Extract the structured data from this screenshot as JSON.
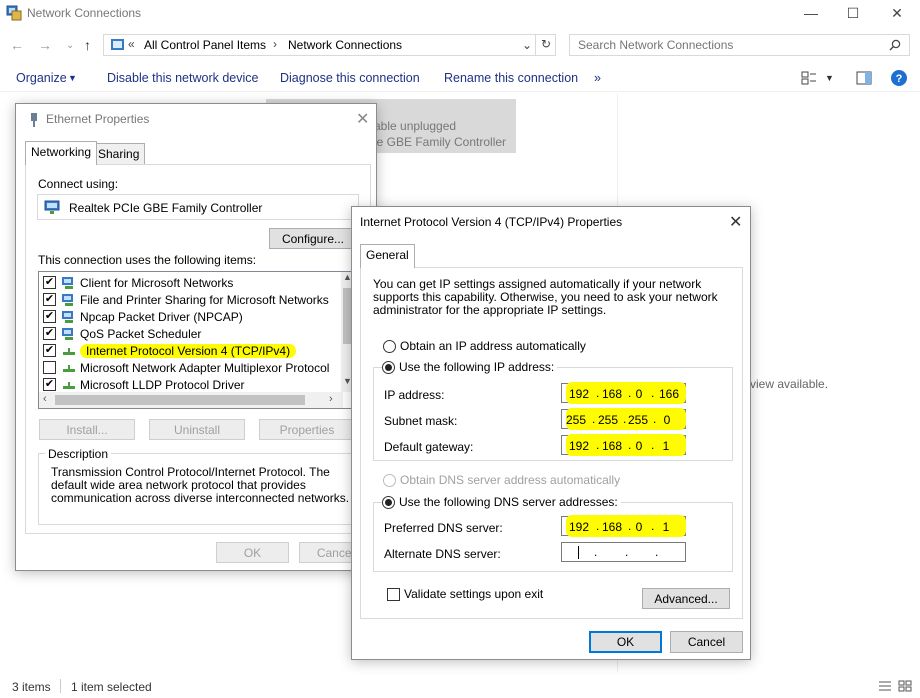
{
  "explorer": {
    "title": "Network Connections",
    "address": {
      "prefix": "«",
      "crumbs": [
        "All Control Panel Items",
        "Network Connections"
      ]
    },
    "search_placeholder": "Search Network Connections",
    "commands": [
      "Organize",
      "Disable this network device",
      "Diagnose this connection",
      "Rename this connection",
      "»"
    ],
    "background_item": {
      "line1": "able unplugged",
      "line2": "le GBE Family Controller"
    },
    "preview_text": "view available.",
    "status": {
      "items": "3 items",
      "selected": "1 item selected"
    }
  },
  "ethernet_dialog": {
    "title": "Ethernet Properties",
    "tabs": [
      "Networking",
      "Sharing"
    ],
    "connect_using_label": "Connect using:",
    "adapter": "Realtek PCIe GBE Family Controller",
    "configure_button": "Configure...",
    "items_label": "This connection uses the following items:",
    "items": [
      {
        "label": "Client for Microsoft Networks",
        "checked": "✔"
      },
      {
        "label": "File and Printer Sharing for Microsoft Networks",
        "checked": "✔"
      },
      {
        "label": "Npcap Packet Driver (NPCAP)",
        "checked": "✔"
      },
      {
        "label": "QoS Packet Scheduler",
        "checked": "✔"
      },
      {
        "label": "Internet Protocol Version 4 (TCP/IPv4)",
        "checked": "✔"
      },
      {
        "label": "Microsoft Network Adapter Multiplexor Protocol",
        "checked": ""
      },
      {
        "label": "Microsoft LLDP Protocol Driver",
        "checked": "✔"
      }
    ],
    "buttons": {
      "install": "Install...",
      "uninstall": "Uninstall",
      "properties": "Properties",
      "ok": "OK",
      "cancel": "Cancel"
    },
    "description_label": "Description",
    "description": "Transmission Control Protocol/Internet Protocol. The default wide area network protocol that provides communication across diverse interconnected networks."
  },
  "ipv4_dialog": {
    "title": "Internet Protocol Version 4 (TCP/IPv4) Properties",
    "tab": "General",
    "intro": "You can get IP settings assigned automatically if your network supports this capability. Otherwise, you need to ask your network administrator for the appropriate IP settings.",
    "obtain_ip_auto": "Obtain an IP address automatically",
    "use_following_ip": "Use the following IP address:",
    "ip_address_label": "IP address:",
    "ip_address": [
      "192",
      "168",
      "0",
      "166"
    ],
    "subnet_mask_label": "Subnet mask:",
    "subnet_mask": [
      "255",
      "255",
      "255",
      "0"
    ],
    "gateway_label": "Default gateway:",
    "gateway": [
      "192",
      "168",
      "0",
      "1"
    ],
    "obtain_dns_auto": "Obtain DNS server address automatically",
    "use_following_dns": "Use the following DNS server addresses:",
    "preferred_dns_label": "Preferred DNS server:",
    "preferred_dns": [
      "192",
      "168",
      "0",
      "1"
    ],
    "alternate_dns_label": "Alternate DNS server:",
    "alternate_dns": [
      "",
      "",
      "",
      ""
    ],
    "validate_label": "Validate settings upon exit",
    "advanced_button": "Advanced...",
    "ok_button": "OK",
    "cancel_button": "Cancel"
  },
  "colors": {
    "highlight": "#fffb00",
    "link_blue": "#1e3287",
    "focus_blue": "#0078d7"
  }
}
